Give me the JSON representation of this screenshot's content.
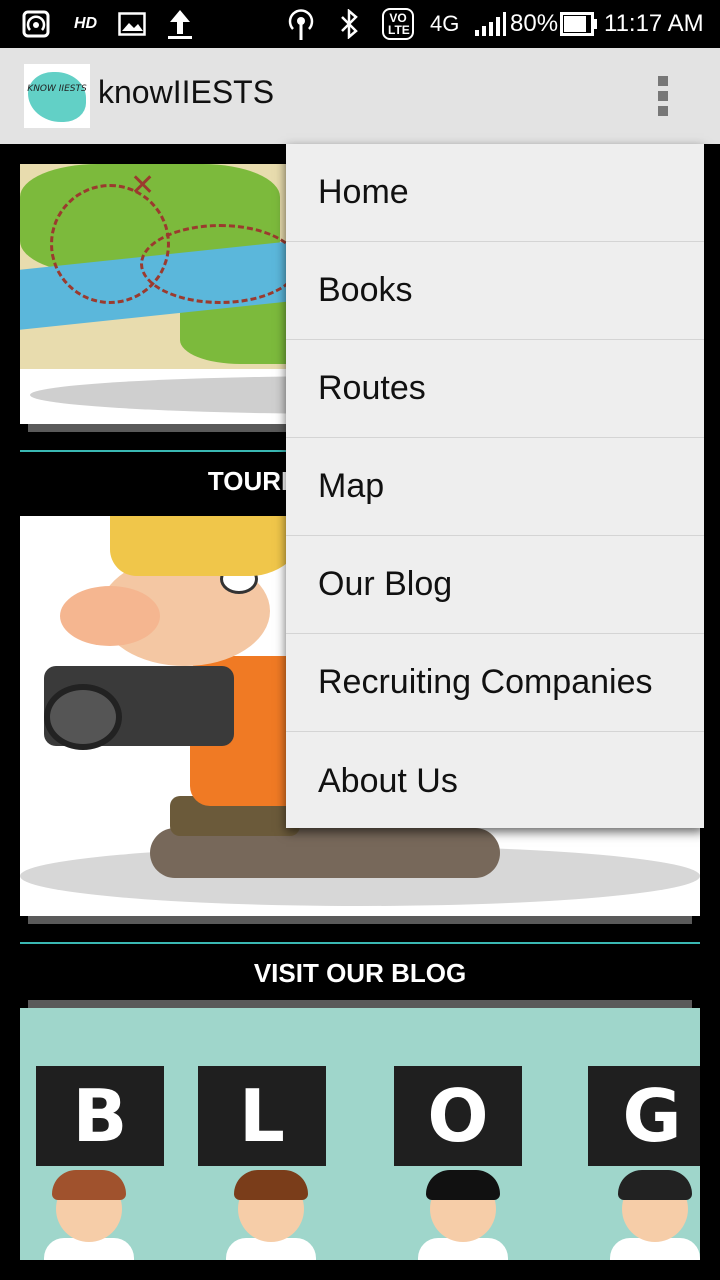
{
  "status_bar": {
    "hd": "HD",
    "volte": "VO LTE",
    "network": "4G",
    "battery": "80%",
    "time": "11:17 AM",
    "icons": [
      "hotspot-icon",
      "image-icon",
      "upload-icon",
      "wireless-icon",
      "bluetooth-icon",
      "signal-icon",
      "battery-icon"
    ]
  },
  "toolbar": {
    "logo_text": "KNOW IIESTS",
    "title": "knowIIESTS",
    "overflow_icon": "more-vert-icon",
    "background": "#e3e3e3"
  },
  "content": {
    "sections": [
      {
        "title": "TOURIST ATTRACTIONS",
        "visible_title": "TOURIST ATTI"
      },
      {
        "title": "VISIT OUR BLOG"
      }
    ],
    "blog_letters": [
      "B",
      "L",
      "O",
      "G"
    ],
    "accent_color": "#3ab8b3"
  },
  "menu": {
    "items": [
      {
        "label": "Home"
      },
      {
        "label": "Books"
      },
      {
        "label": "Routes"
      },
      {
        "label": "Map"
      },
      {
        "label": "Our Blog"
      },
      {
        "label": "Recruiting Companies"
      },
      {
        "label": "About Us"
      }
    ]
  }
}
